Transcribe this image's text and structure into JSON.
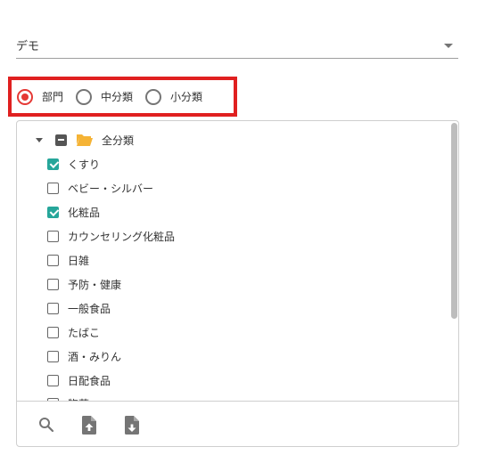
{
  "select": {
    "value": "デモ"
  },
  "radios": [
    {
      "label": "部門",
      "checked": true
    },
    {
      "label": "中分類",
      "checked": false
    },
    {
      "label": "小分類",
      "checked": false
    }
  ],
  "tree": {
    "root_label": "全分類",
    "items": [
      {
        "label": "くすり",
        "checked": true
      },
      {
        "label": "ベビー・シルバー",
        "checked": false
      },
      {
        "label": "化粧品",
        "checked": true
      },
      {
        "label": "カウンセリング化粧品",
        "checked": false
      },
      {
        "label": "日雑",
        "checked": false
      },
      {
        "label": "予防・健康",
        "checked": false
      },
      {
        "label": "一般食品",
        "checked": false
      },
      {
        "label": "たばこ",
        "checked": false
      },
      {
        "label": "酒・みりん",
        "checked": false
      },
      {
        "label": "日配食品",
        "checked": false
      },
      {
        "label": "惣菜",
        "checked": false
      }
    ]
  },
  "footer": {
    "icons": [
      "search-icon",
      "file-upload-icon",
      "file-download-icon"
    ]
  },
  "colors": {
    "accent_red": "#e53935",
    "check_teal": "#26a69a",
    "folder": "#f5b335"
  }
}
